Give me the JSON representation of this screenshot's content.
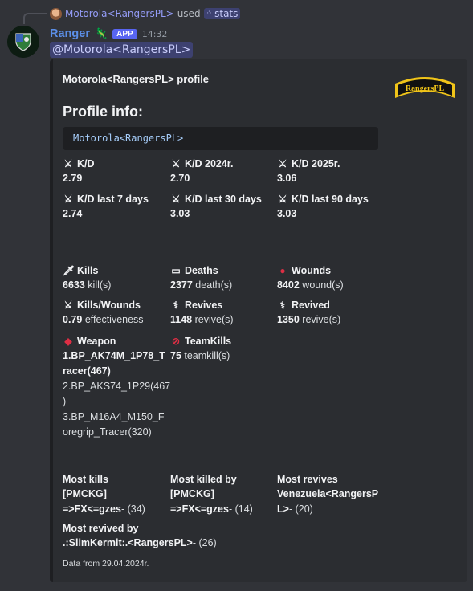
{
  "reply": {
    "user": "Motorola<RangersPL>",
    "used_text": "used",
    "command": "stats"
  },
  "message": {
    "bot_name": "Ranger",
    "bot_emoji": "🦎",
    "app_badge": "APP",
    "time": "14:32",
    "mention": "@Motorola<RangersPL>"
  },
  "embed": {
    "author": "Motorola<RangersPL> profile",
    "title": "Profile info:",
    "code": "Motorola<RangersPL>",
    "thumbnail_text": "RangersPL",
    "kd_fields": [
      {
        "name": "K/D",
        "value": "2.79",
        "icon": "crossed-swords-icon"
      },
      {
        "name": "K/D 2024r.",
        "value": "2.70",
        "icon": "crossed-swords-icon"
      },
      {
        "name": "K/D 2025r.",
        "value": "3.06",
        "icon": "crossed-swords-icon"
      },
      {
        "name": "K/D last 7 days",
        "value": "2.74",
        "icon": "crossed-swords-icon"
      },
      {
        "name": "K/D last 30 days",
        "value": "3.03",
        "icon": "crossed-swords-icon"
      },
      {
        "name": "K/D last 90 days",
        "value": "3.03",
        "icon": "crossed-swords-icon"
      }
    ],
    "kills": {
      "name": "Kills",
      "num": "6633",
      "unit": " kill(s)"
    },
    "deaths": {
      "name": "Deaths",
      "num": "2377",
      "unit": " death(s)"
    },
    "wounds": {
      "name": "Wounds",
      "num": "8402",
      "unit": " wound(s)"
    },
    "kills_wounds": {
      "name": "Kills/Wounds",
      "num": "0.79",
      "unit": " effectiveness"
    },
    "revives": {
      "name": "Revives",
      "num": "1148",
      "unit": " revive(s)"
    },
    "revived": {
      "name": "Revived",
      "num": "1350",
      "unit": " revive(s)"
    },
    "weapon": {
      "name": "Weapon",
      "first": "1.BP_AK74M_1P78_T\nracer(467)",
      "rest": "2.BP_AKS74_1P29(467\n)\n3.BP_M16A4_M150_F\noregrip_Tracer(320)"
    },
    "teamkills": {
      "name": "TeamKills",
      "num": "75",
      "unit": " teamkill(s)"
    },
    "most_kills": {
      "name": "Most kills",
      "player": "[PMCKG]\n=>FX<=gzes",
      "count": "- (34)"
    },
    "most_killed_by": {
      "name": "Most killed by",
      "player": "[PMCKG]\n=>FX<=gzes",
      "count": "- (14)"
    },
    "most_revives": {
      "name": "Most revives",
      "player": "Venezuela<RangersP\nL>",
      "count": "- (20)"
    },
    "most_revived_by": {
      "name": "Most revived by",
      "player": ".:SlimKermit:.<RangersPL>",
      "count": "- (26)"
    },
    "footer": "Data from 29.04.2024r."
  },
  "colors": {
    "background": "#313338",
    "embed_bg": "#2b2d31",
    "bot_name": "#5b8ee6",
    "mention": "#c9cdfb",
    "thumbnail": "#f0c419"
  }
}
